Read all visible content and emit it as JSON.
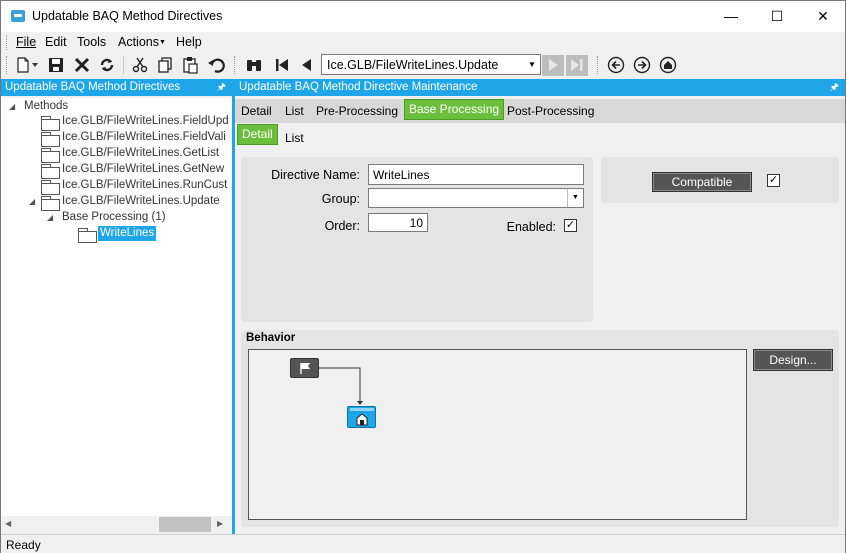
{
  "window": {
    "title": "Updatable BAQ Method Directives",
    "minimize": "—",
    "maximize": "☐",
    "close": "✕"
  },
  "menu": {
    "file": "File",
    "edit": "Edit",
    "tools": "Tools",
    "actions": "Actions",
    "help": "Help"
  },
  "toolbar": {
    "method_value": "Ice.GLB/FileWriteLines.Update",
    "icons": [
      "new-icon",
      "save-icon",
      "delete-icon",
      "refresh-icon",
      "cut-icon",
      "copy-icon",
      "paste-icon",
      "undo-icon",
      "search-binoculars-icon",
      "first-record-icon",
      "previous-record-icon",
      "next-record-icon",
      "last-record-icon",
      "back-icon",
      "forward-icon",
      "home-icon"
    ]
  },
  "left_panel": {
    "header": "Updatable BAQ Method Directives",
    "pin": "📌",
    "tree": {
      "root_label": "Methods",
      "methods": [
        "Ice.GLB/FileWriteLines.FieldUpd",
        "Ice.GLB/FileWriteLines.FieldVali",
        "Ice.GLB/FileWriteLines.GetList",
        "Ice.GLB/FileWriteLines.GetNew",
        "Ice.GLB/FileWriteLines.RunCust",
        "Ice.GLB/FileWriteLines.Update"
      ],
      "group_label": "Base Processing (1)",
      "selected_label": "WriteLines"
    }
  },
  "main_panel": {
    "header": "Updatable BAQ Method Directive Maintenance",
    "tabs": [
      "Detail",
      "List",
      "Pre-Processing",
      "Base Processing",
      "Post-Processing"
    ],
    "active_tab": "Base Processing",
    "subtabs": [
      "Detail",
      "List"
    ],
    "active_subtab": "Detail",
    "form": {
      "directive_name_label": "Directive Name:",
      "directive_name_value": "WriteLines",
      "group_label": "Group:",
      "group_value": "",
      "order_label": "Order:",
      "order_value": "10",
      "enabled_label": "Enabled:",
      "enabled_checked": "✓"
    },
    "compatible": {
      "button_label": "Compatible",
      "checked": "✓"
    },
    "behavior": {
      "label": "Behavior",
      "design_button": "Design..."
    }
  },
  "status": {
    "text": "Ready"
  },
  "colors": {
    "accent_blue": "#1ea6e8",
    "tab_green": "#6cbf3c",
    "dark_button": "#555555"
  }
}
